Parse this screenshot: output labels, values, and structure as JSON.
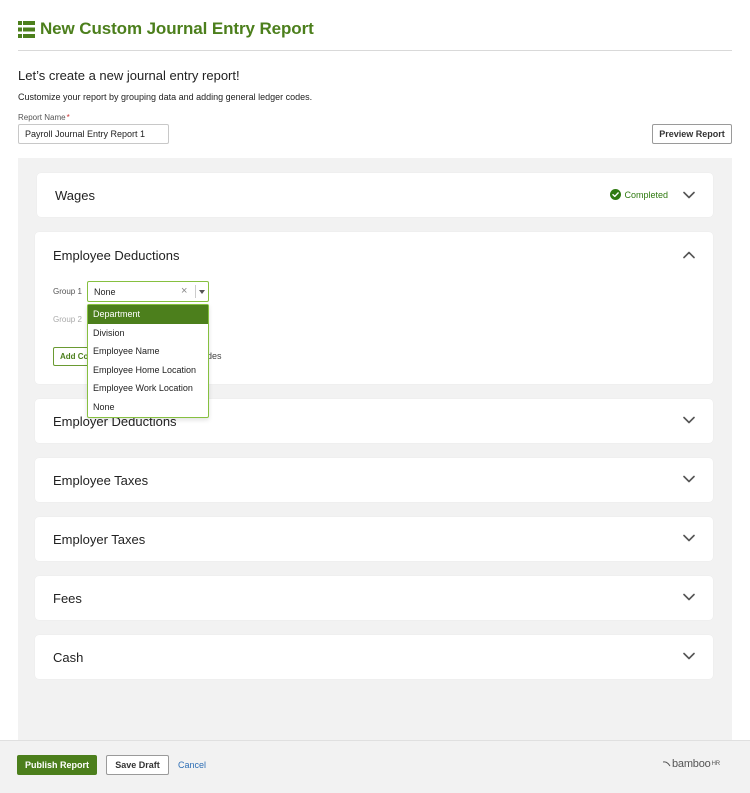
{
  "header": {
    "title": "New Custom Journal Entry Report"
  },
  "intro": {
    "heading": "Let’s create a new journal entry report!",
    "subtext": "Customize your report by grouping data and adding general ledger codes."
  },
  "report_name": {
    "label": "Report Name",
    "required_mark": "*",
    "value": "Payroll Journal Entry Report 1"
  },
  "preview_button": "Preview Report",
  "sections": {
    "wages": {
      "title": "Wages",
      "status": "Completed"
    },
    "employee_deductions": {
      "title": "Employee Deductions",
      "group1_label": "Group 1",
      "group1_value": "None",
      "group2_label": "Group 2",
      "add_button": "Add Co",
      "add_trailing": "des"
    },
    "employer_deductions": {
      "title": "Employer Deductions"
    },
    "employee_taxes": {
      "title": "Employee Taxes"
    },
    "employer_taxes": {
      "title": "Employer Taxes"
    },
    "fees": {
      "title": "Fees"
    },
    "cash": {
      "title": "Cash"
    }
  },
  "dropdown": {
    "options": [
      "Department",
      "Division",
      "Employee Name",
      "Employee Home Location",
      "Employee Work Location",
      "None"
    ],
    "highlighted": "Department"
  },
  "footer": {
    "publish": "Publish Report",
    "save_draft": "Save Draft",
    "cancel": "Cancel",
    "logo": "bamboo",
    "logo_suffix": "HR"
  },
  "colors": {
    "brand_green": "#4c7f1c",
    "success_green": "#2f7a10",
    "link_blue": "#2e6fb5",
    "focus_green": "#86c040"
  }
}
